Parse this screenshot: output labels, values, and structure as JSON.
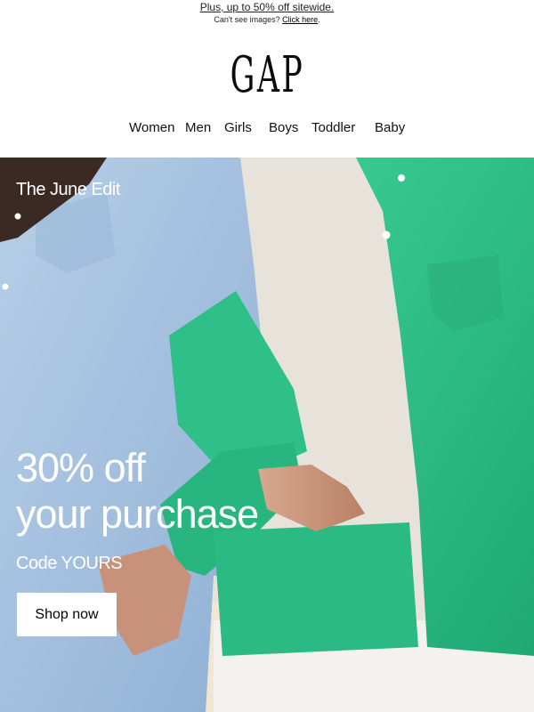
{
  "header": {
    "promo_link": "Plus, up to 50% off sitewide.",
    "image_note_prefix": "Can't see images?",
    "image_note_link": "Click here",
    "image_note_suffix": ".",
    "logo_text": "GAP"
  },
  "nav": {
    "items": [
      "Women",
      "Men",
      "Girls",
      "Boys",
      "Toddler",
      "Baby"
    ]
  },
  "hero": {
    "edit_label": "The June Edit",
    "headline_line1": "30% off",
    "headline_line2": "your purchase",
    "code_text": "Code YOURS",
    "cta_label": "Shop now"
  },
  "colors": {
    "blue_shirt": "#a7c3e0",
    "green_shirt": "#33c08a",
    "cta_background": "#ffffff"
  }
}
